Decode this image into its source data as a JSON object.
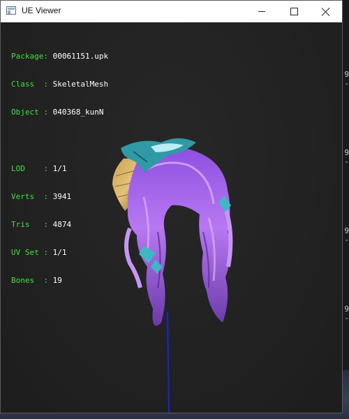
{
  "window": {
    "title": "UE Viewer"
  },
  "info": {
    "package": {
      "key": "Package:",
      "value": "00061151.upk"
    },
    "class": {
      "key": "Class  :",
      "value": "SkeletalMesh"
    },
    "object": {
      "key": "Object :",
      "value": "040368_kunN"
    },
    "lod": {
      "key": "LOD    :",
      "value": "1/1"
    },
    "verts": {
      "key": "Verts  :",
      "value": "3941"
    },
    "tris": {
      "key": "Tris   :",
      "value": "4874"
    },
    "uvset": {
      "key": "UV Set :",
      "value": "1/1"
    },
    "bones": {
      "key": "Bones  :",
      "value": "19"
    }
  },
  "colors": {
    "label": "#3fe23f",
    "value": "#ffffff",
    "hair": "#b66ef0",
    "accessory": "#3fb7c4",
    "axis": "#1a24d6"
  },
  "icons": [
    "app-icon",
    "minimize-icon",
    "maximize-icon",
    "close-icon"
  ]
}
